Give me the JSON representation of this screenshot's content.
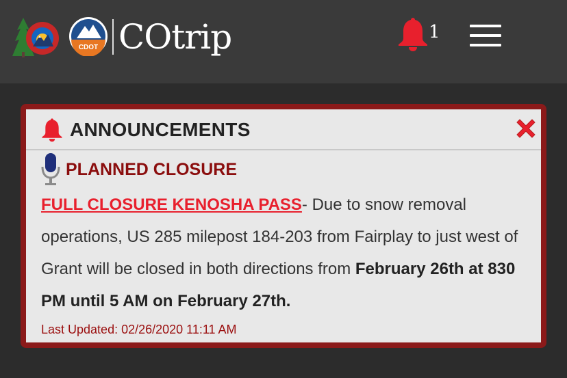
{
  "app": {
    "brand_name": "COtrip",
    "cdot_label": "CDOT",
    "notification_count": "1"
  },
  "announcements": {
    "header": "ANNOUNCEMENTS",
    "category": "PLANNED CLOSURE",
    "link_text": "FULL CLOSURE KENOSHA PASS",
    "body_text": "- Due to snow removal operations, US 285 milepost 184-203 from Fairplay to just west of Grant will be closed in both directions from ",
    "body_bold": "February 26th at 830 PM until 5 AM on February 27th.",
    "last_updated": "Last Updated: 02/26/2020 11:11 AM"
  },
  "icons": {
    "bell": "bell-icon",
    "menu": "hamburger-menu-icon",
    "close": "close-icon",
    "mic": "microphone-icon"
  },
  "colors": {
    "alert_red": "#e8202d",
    "panel_border": "#8b1a1a",
    "header_bg": "#3a3a3a"
  }
}
